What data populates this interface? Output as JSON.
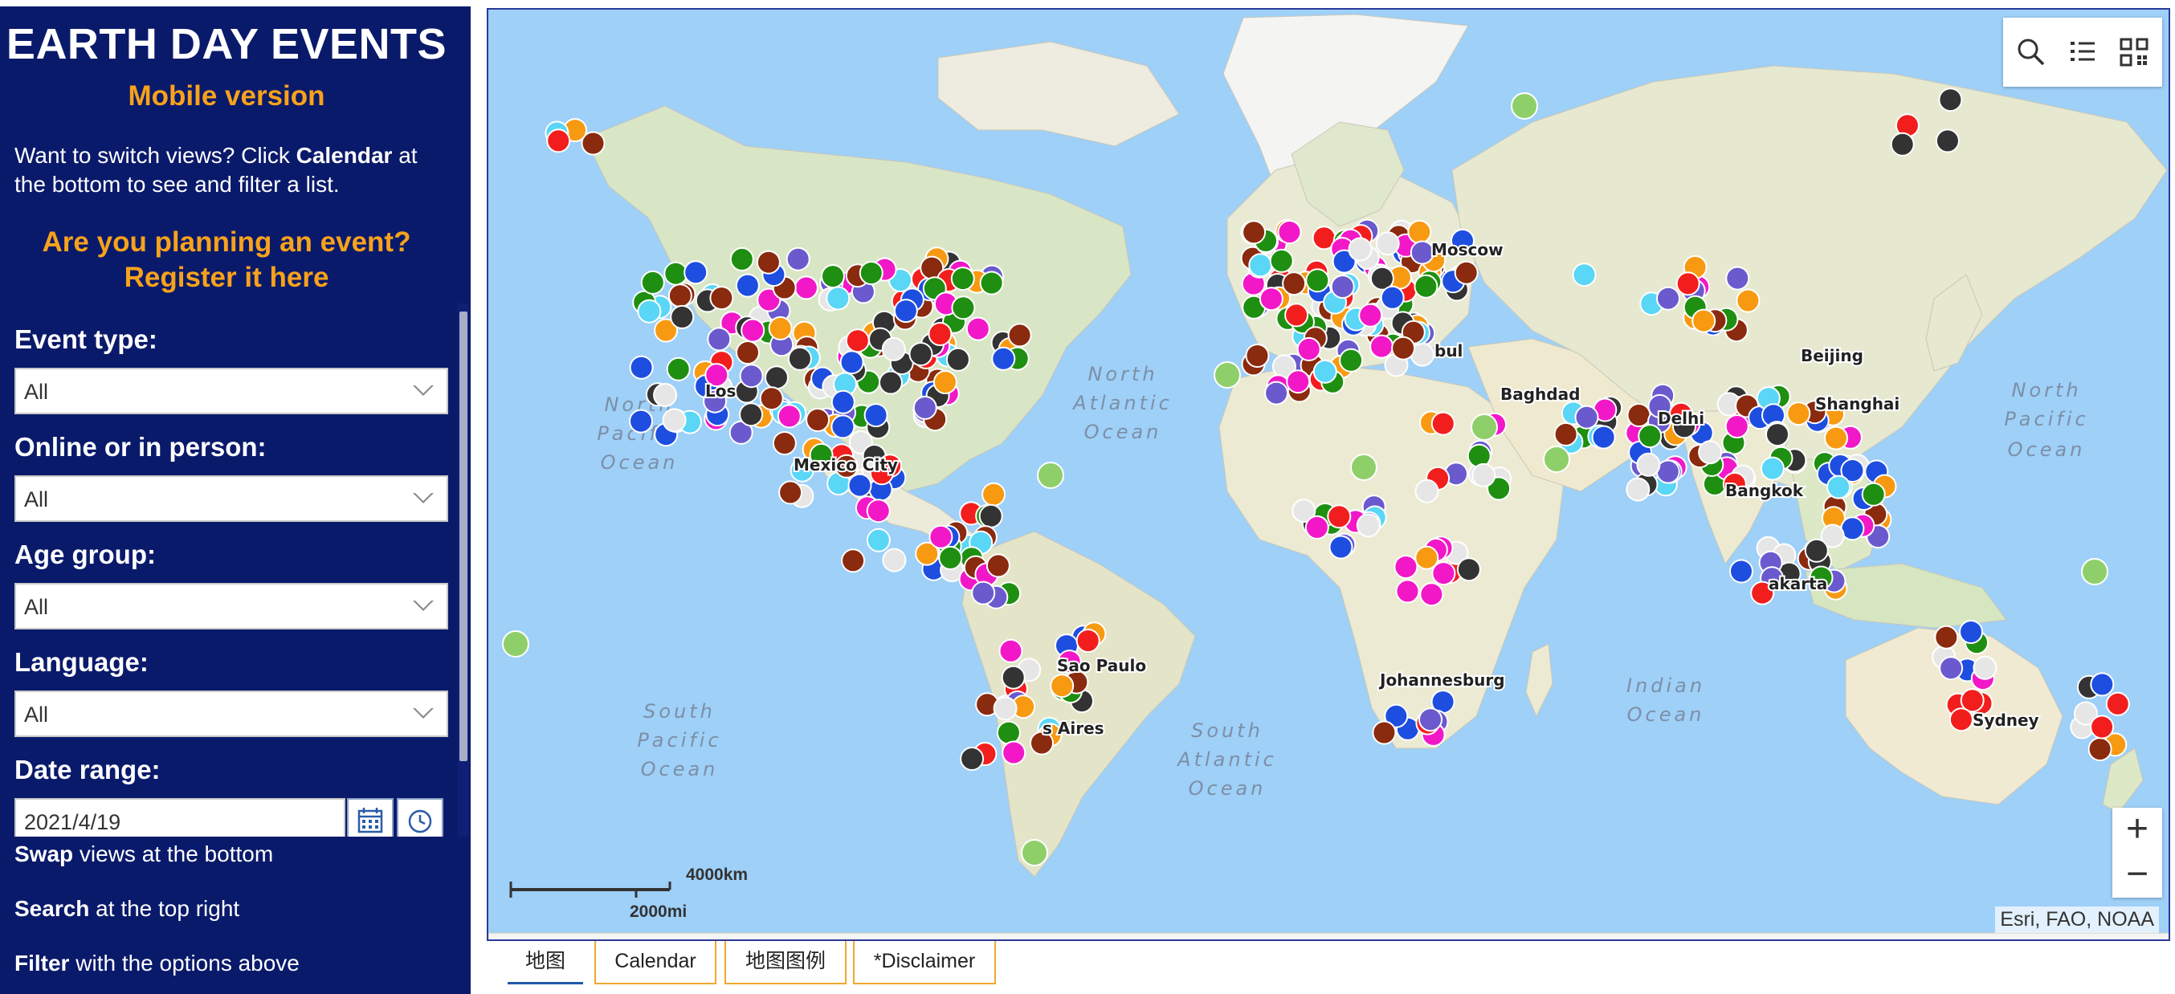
{
  "sidebar": {
    "title": "EARTH DAY EVENTS",
    "subtitle": "Mobile version",
    "intro_prefix": "Want to switch views? Click ",
    "intro_bold": "Calendar",
    "intro_suffix": " at the bottom to see and filter a list.",
    "register_line1": "Are you planning an event?",
    "register_line2": "Register it here",
    "filters": [
      {
        "label": "Event type:",
        "value": "All"
      },
      {
        "label": "Online or in person:",
        "value": "All"
      },
      {
        "label": "Age group:",
        "value": "All"
      },
      {
        "label": "Language:",
        "value": "All"
      }
    ],
    "date_label": "Date range:",
    "date_value": "2021/4/19",
    "tips": [
      {
        "bold": "Swap",
        "text": " views at the bottom"
      },
      {
        "bold": "Search",
        "text": " at the top right"
      },
      {
        "bold": "Filter",
        "text": " with the options above"
      }
    ]
  },
  "map": {
    "labels": {
      "north_pacific_left": [
        "North",
        "Pacific",
        "Ocean"
      ],
      "north_pacific_right": [
        "North",
        "Pacific",
        "Ocean"
      ],
      "north_atlantic": [
        "North",
        "Atlantic",
        "Ocean"
      ],
      "south_pacific": [
        "South",
        "Pacific",
        "Ocean"
      ],
      "south_atlantic": [
        "South",
        "Atlantic",
        "Ocean"
      ],
      "indian": [
        "Indian",
        "Ocean"
      ],
      "moscow": "Moscow",
      "baghdad": "Baghdad",
      "beijing": "Beijing",
      "johannesburg": "Johannesburg",
      "sydney": "Sydney",
      "sao_paulo": "Sao Paulo",
      "delhi": "Delhi",
      "bangkok": "Bangkok",
      "mexico_city": "Mexico City",
      "los_angeles": "Los",
      "istanbul": "bul",
      "shanghai": "Shanghai",
      "buenos_aires": "s Aires",
      "jakarta": "akarta"
    },
    "scale_km": "4000km",
    "scale_mi": "2000mi",
    "attribution": "Esri, FAO, NOAA",
    "zoom_in": "+",
    "zoom_out": "−",
    "colors": {
      "ocean": "#9ed0f8",
      "land": "#ecead8",
      "green_land": "#cde4bd",
      "ice": "#f7f7f7",
      "marker_colors": [
        "#1e8f10",
        "#f79a12",
        "#1e4ee0",
        "#f21e1e",
        "#f218c8",
        "#5ad6f6",
        "#8a2a0e",
        "#333333",
        "#e6e6e6",
        "#6a5acd"
      ]
    }
  },
  "tabs": [
    {
      "label": "地图",
      "active": true
    },
    {
      "label": "Calendar",
      "active": false
    },
    {
      "label": "地图图例",
      "active": false
    },
    {
      "label": "*Disclaimer",
      "active": false
    }
  ]
}
